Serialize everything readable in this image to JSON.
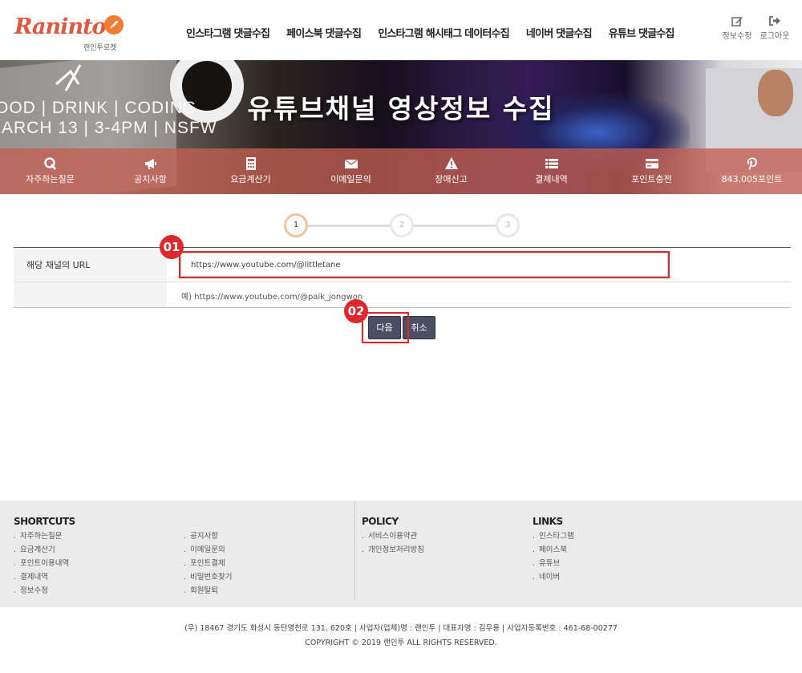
{
  "logo": {
    "name": "Raninto",
    "sub": "랜인투로켓"
  },
  "nav": [
    "인스타그램 댓글수집",
    "페이스북 댓글수집",
    "인스타그램 해시태그 데이터수집",
    "네이버 댓글수집",
    "유튜브 댓글수집"
  ],
  "header_util": {
    "edit_label": "정보수정",
    "logout_label": "로그아웃"
  },
  "banner": {
    "title": "유튜브채널 영상정보 수집",
    "bg_text_1": "OOD | DRINK | CODING",
    "bg_text_2": "ARCH 13 | 3-4PM | NSFW"
  },
  "quick_menu": [
    {
      "icon": "q-icon",
      "label": "자주하는질문"
    },
    {
      "icon": "megaphone-icon",
      "label": "공지사항"
    },
    {
      "icon": "calculator-icon",
      "label": "요금계산기"
    },
    {
      "icon": "envelope-icon",
      "label": "이메일문의"
    },
    {
      "icon": "warning-icon",
      "label": "장애신고"
    },
    {
      "icon": "list-icon",
      "label": "결제내역"
    },
    {
      "icon": "credit-card-icon",
      "label": "포인트충전"
    },
    {
      "icon": "pinterest-icon",
      "label": "843,005포인트"
    }
  ],
  "steps": [
    "1",
    "2",
    "3"
  ],
  "form": {
    "url_label": "해당 채널의 URL",
    "url_value": "https://www.youtube.com/@littletane",
    "hint": "예) https://www.youtube.com/@paik_jongwon"
  },
  "markers": {
    "m1": "01",
    "m2": "02"
  },
  "buttons": {
    "next": "다음",
    "cancel": "취소"
  },
  "footer": {
    "shortcuts_title": "SHORTCUTS",
    "shortcuts_col1": [
      "자주하는질문",
      "요금계산기",
      "포인트이용내역",
      "결제내역",
      "정보수정"
    ],
    "shortcuts_col2": [
      "공지사항",
      "이메일문의",
      "포인트결제",
      "비밀번호찾기",
      "회원탈퇴"
    ],
    "policy_title": "POLICY",
    "policy": [
      "서비스이용약관",
      "개인정보처리방침"
    ],
    "links_title": "LINKS",
    "links": [
      "인스타그램",
      "페이스북",
      "유튜브",
      "네이버"
    ],
    "address": "(우) 18467 경기도 화성시 동탄영천로 131, 620호 | 사업자(업체)명 : 랜인투 | 대표자명 : 김우용 | 사업자등록번호 : 461-68-00277",
    "copyright": "COPYRIGHT © 2019 랜인투 ALL RIGHTS RESERVED."
  },
  "colors": {
    "accent_red": "#e0282c",
    "logo_orange": "#e2583e",
    "button": "#4a4f66",
    "quickbar": "#c45f52"
  }
}
